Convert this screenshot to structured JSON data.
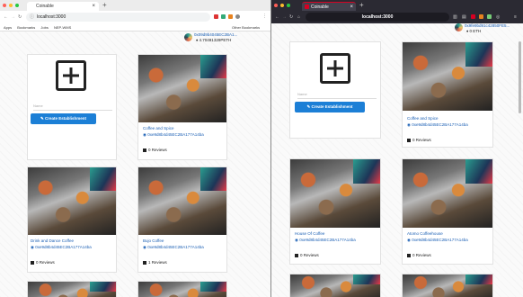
{
  "left_browser": {
    "tab_title": "Coinable",
    "url": "localhost:3000",
    "bookmarks": [
      "Apps",
      "Bookmarks",
      "Jobs",
      "NEP-WMS",
      "Other Bookmarks"
    ],
    "account": {
      "address": "0x09d9b4045EC2BA1...",
      "balance": "4.70491329PETH"
    },
    "create_card": {
      "name_placeholder": "Name",
      "button_label": "Create Establishment"
    },
    "cards": [
      {
        "name": "Coffee and Spice",
        "owner": "0xe9d8b4d45EC2BA177A14ba",
        "reviews": "0 Reviews"
      },
      {
        "name": "Drink and Dance Coffee",
        "owner": "0xe9d8b4d45EC2BA177A14ba",
        "reviews": "0 Reviews"
      },
      {
        "name": "Bujo Coffee",
        "owner": "0xe9d8b4d45EC2BA177A14ba",
        "reviews": "1 Reviews"
      }
    ]
  },
  "right_browser": {
    "tab_title": "Coinable",
    "url": "localhost:3000",
    "account": {
      "address": "0x9fe9bd91c42850FE5...",
      "balance": "0 ETH"
    },
    "create_card": {
      "name_placeholder": "Name",
      "button_label": "Create Establishment"
    },
    "cards": [
      {
        "name": "Coffee and Spice",
        "owner": "0xe9d8b4d45EC2BA177A14ba",
        "reviews": "0 Reviews"
      },
      {
        "name": "House Of Coffee",
        "owner": "0xe9d8b4d45EC2BA177A14ba",
        "reviews": "0 Reviews"
      },
      {
        "name": "Atomo Coffeehouse",
        "owner": "0xe9d8b4d45EC2BA177A14ba",
        "reviews": "0 Reviews"
      }
    ]
  },
  "colors": {
    "accent": "#1c7fd6",
    "link": "#1a5fb4",
    "firefox_chrome": "#2b2a33",
    "firefox_tab": "#d70022"
  }
}
